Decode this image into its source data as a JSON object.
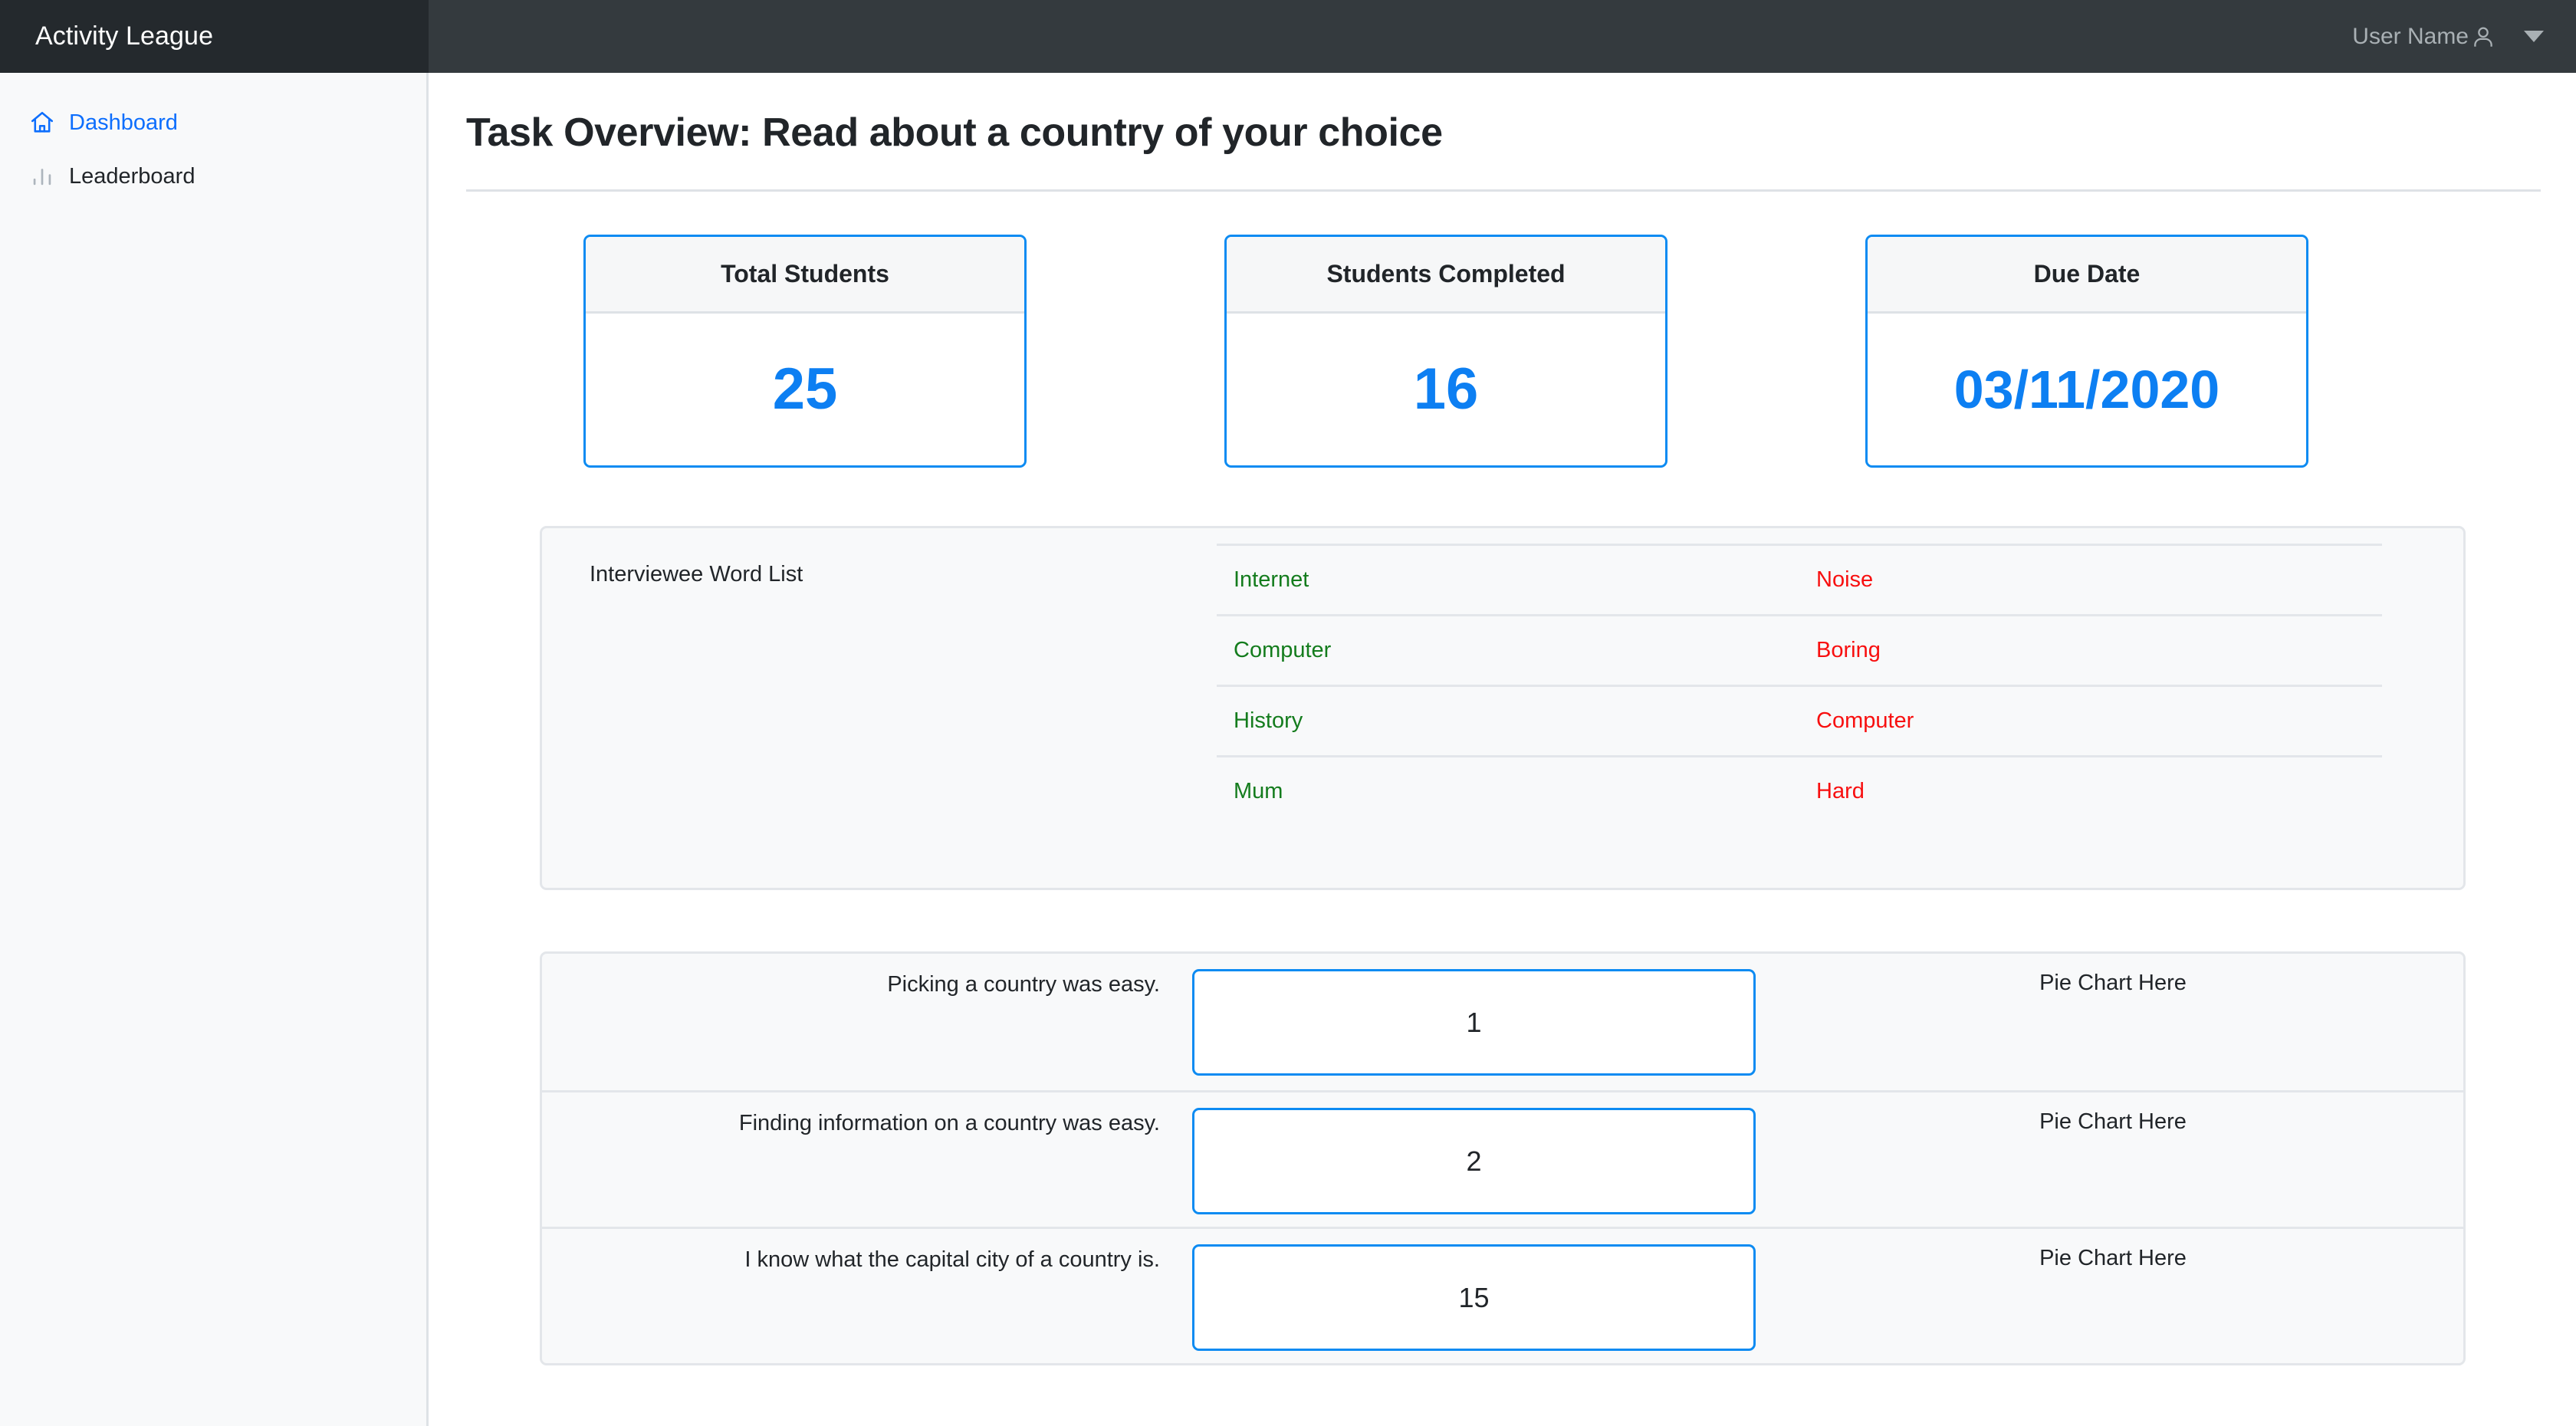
{
  "topbar": {
    "brand": "Activity League",
    "user_name": "User Name",
    "user_icon": "user-icon",
    "caret_icon": "chevron-down-icon"
  },
  "sidebar": {
    "items": [
      {
        "label": "Dashboard",
        "icon": "home-icon",
        "active": true
      },
      {
        "label": "Leaderboard",
        "icon": "bar-chart-icon",
        "active": false
      }
    ]
  },
  "main": {
    "page_title": "Task Overview: Read about a country of your choice",
    "stat_cards": [
      {
        "title": "Total Students",
        "value": "25"
      },
      {
        "title": "Students Completed",
        "value": "16"
      },
      {
        "title": "Due Date",
        "value": "03/11/2020"
      }
    ],
    "word_list": {
      "label": "Interviewee Word List",
      "positive_words": [
        "Internet",
        "Computer",
        "History",
        "Mum"
      ],
      "negative_words": [
        "Noise",
        "Boring",
        "Computer",
        "Hard"
      ]
    },
    "survey": {
      "chart_placeholder": "Pie Chart Here",
      "rows": [
        {
          "question": "Picking a country was easy.",
          "value": "1"
        },
        {
          "question": "Finding information on a country was easy.",
          "value": "2"
        },
        {
          "question": "I know what the capital city of a country is.",
          "value": "15"
        }
      ]
    }
  },
  "colors": {
    "accent_blue": "#0d7ff2",
    "border_blue": "#0d8bf2",
    "positive_green": "#147c1d",
    "negative_red": "#f80f0f",
    "topbar_dark": "#343a3e",
    "brand_dark": "#24292d"
  }
}
